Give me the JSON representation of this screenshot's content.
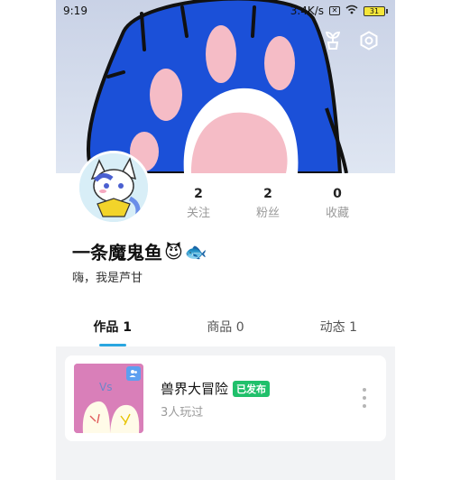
{
  "status_bar": {
    "time": "9:19",
    "network_speed": "3.4K/s",
    "battery": "31",
    "icons": [
      "sim-off-icon",
      "wifi-icon",
      "battery-icon"
    ]
  },
  "cover": {
    "buttons": [
      "plant-icon",
      "settings-icon"
    ]
  },
  "profile": {
    "name": "一条魔鬼鱼",
    "name_emojis": [
      "😈",
      "🐟"
    ],
    "bio": "嗨，我是芦甘",
    "stats": [
      {
        "value": "2",
        "label": "关注"
      },
      {
        "value": "2",
        "label": "粉丝"
      },
      {
        "value": "0",
        "label": "收藏"
      }
    ]
  },
  "tabs": [
    {
      "label": "作品 1",
      "active": true
    },
    {
      "label": "商品 0",
      "active": false
    },
    {
      "label": "动态 1",
      "active": false
    }
  ],
  "works": [
    {
      "title": "兽界大冒险",
      "status": "已发布",
      "plays": "3人玩过"
    }
  ],
  "colors": {
    "accent": "#2aa6e0",
    "published": "#20c06b",
    "cover_blue": "#1b50d8",
    "paw_pink": "#f5bcc6"
  }
}
